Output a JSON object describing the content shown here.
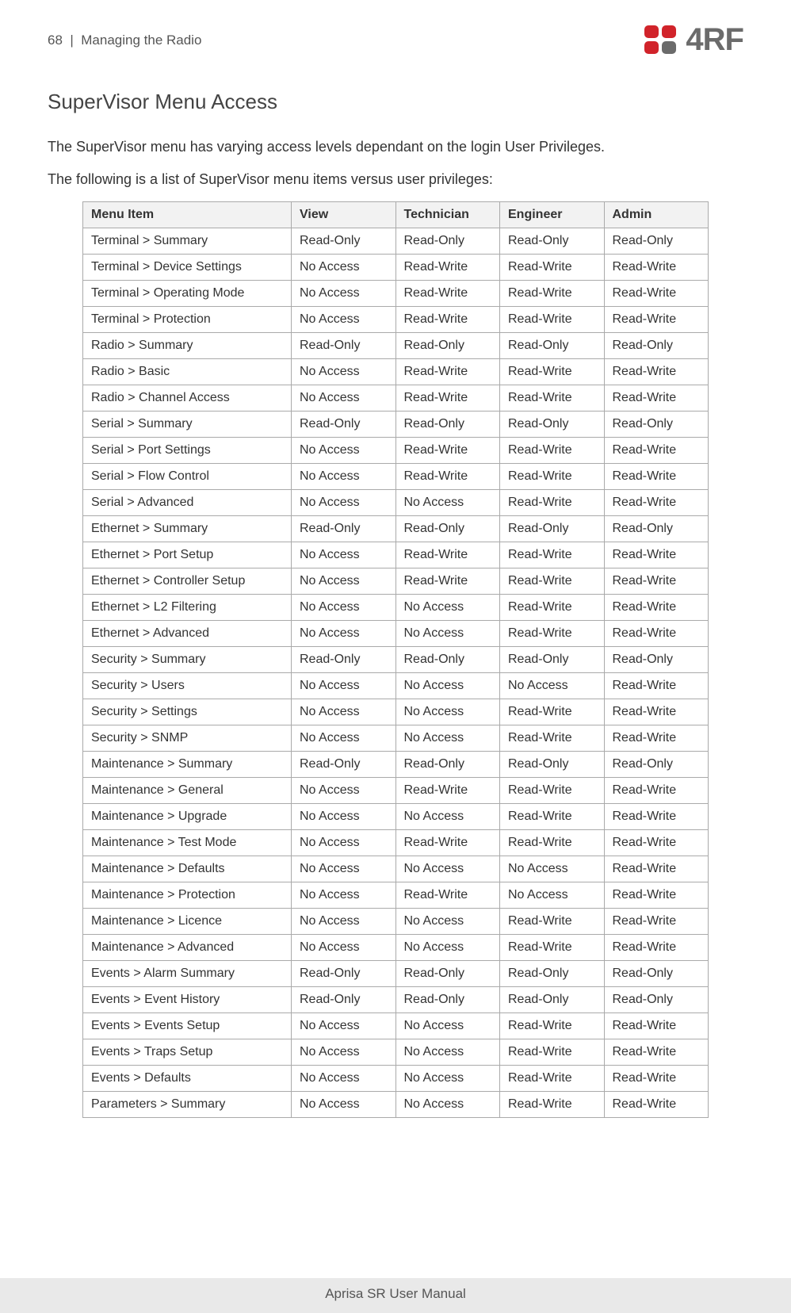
{
  "header": {
    "page_number": "68",
    "separator": "|",
    "chapter": "Managing the Radio",
    "logo_text": "4RF"
  },
  "section_title": "SuperVisor Menu Access",
  "paragraphs": [
    "The SuperVisor menu has varying access levels dependant on the login User Privileges.",
    "The following is a list of SuperVisor menu items versus user privileges:"
  ],
  "table": {
    "headers": [
      "Menu Item",
      "View",
      "Technician",
      "Engineer",
      "Admin"
    ],
    "rows": [
      [
        "Terminal > Summary",
        "Read-Only",
        "Read-Only",
        "Read-Only",
        "Read-Only"
      ],
      [
        "Terminal > Device Settings",
        "No Access",
        "Read-Write",
        "Read-Write",
        "Read-Write"
      ],
      [
        "Terminal > Operating Mode",
        "No Access",
        "Read-Write",
        "Read-Write",
        "Read-Write"
      ],
      [
        "Terminal > Protection",
        "No Access",
        "Read-Write",
        "Read-Write",
        "Read-Write"
      ],
      [
        "Radio > Summary",
        "Read-Only",
        "Read-Only",
        "Read-Only",
        "Read-Only"
      ],
      [
        "Radio > Basic",
        "No Access",
        "Read-Write",
        "Read-Write",
        "Read-Write"
      ],
      [
        "Radio > Channel Access",
        "No Access",
        "Read-Write",
        "Read-Write",
        "Read-Write"
      ],
      [
        "Serial > Summary",
        "Read-Only",
        "Read-Only",
        "Read-Only",
        "Read-Only"
      ],
      [
        "Serial > Port Settings",
        "No Access",
        "Read-Write",
        "Read-Write",
        "Read-Write"
      ],
      [
        "Serial > Flow Control",
        "No Access",
        "Read-Write",
        "Read-Write",
        "Read-Write"
      ],
      [
        "Serial > Advanced",
        "No Access",
        "No Access",
        "Read-Write",
        "Read-Write"
      ],
      [
        "Ethernet > Summary",
        "Read-Only",
        "Read-Only",
        "Read-Only",
        "Read-Only"
      ],
      [
        "Ethernet > Port Setup",
        "No Access",
        "Read-Write",
        "Read-Write",
        "Read-Write"
      ],
      [
        "Ethernet > Controller Setup",
        "No Access",
        "Read-Write",
        "Read-Write",
        "Read-Write"
      ],
      [
        "Ethernet > L2 Filtering",
        "No Access",
        "No Access",
        "Read-Write",
        "Read-Write"
      ],
      [
        "Ethernet > Advanced",
        "No Access",
        "No Access",
        "Read-Write",
        "Read-Write"
      ],
      [
        "Security > Summary",
        "Read-Only",
        "Read-Only",
        "Read-Only",
        "Read-Only"
      ],
      [
        "Security > Users",
        "No Access",
        "No Access",
        "No Access",
        "Read-Write"
      ],
      [
        "Security > Settings",
        "No Access",
        "No Access",
        "Read-Write",
        "Read-Write"
      ],
      [
        "Security > SNMP",
        "No Access",
        "No Access",
        "Read-Write",
        "Read-Write"
      ],
      [
        "Maintenance > Summary",
        "Read-Only",
        "Read-Only",
        "Read-Only",
        "Read-Only"
      ],
      [
        "Maintenance > General",
        "No Access",
        "Read-Write",
        "Read-Write",
        "Read-Write"
      ],
      [
        "Maintenance > Upgrade",
        "No Access",
        "No Access",
        "Read-Write",
        "Read-Write"
      ],
      [
        "Maintenance > Test Mode",
        "No Access",
        "Read-Write",
        "Read-Write",
        "Read-Write"
      ],
      [
        "Maintenance > Defaults",
        "No Access",
        "No Access",
        "No Access",
        "Read-Write"
      ],
      [
        "Maintenance > Protection",
        "No Access",
        "Read-Write",
        "No Access",
        "Read-Write"
      ],
      [
        "Maintenance > Licence",
        "No Access",
        "No Access",
        "Read-Write",
        "Read-Write"
      ],
      [
        "Maintenance > Advanced",
        "No Access",
        "No Access",
        "Read-Write",
        "Read-Write"
      ],
      [
        "Events > Alarm Summary",
        "Read-Only",
        "Read-Only",
        "Read-Only",
        "Read-Only"
      ],
      [
        "Events > Event History",
        "Read-Only",
        "Read-Only",
        "Read-Only",
        "Read-Only"
      ],
      [
        "Events > Events Setup",
        "No Access",
        "No Access",
        "Read-Write",
        "Read-Write"
      ],
      [
        "Events > Traps Setup",
        "No Access",
        "No Access",
        "Read-Write",
        "Read-Write"
      ],
      [
        "Events > Defaults",
        "No Access",
        "No Access",
        "Read-Write",
        "Read-Write"
      ],
      [
        "Parameters > Summary",
        "No Access",
        "No Access",
        "Read-Write",
        "Read-Write"
      ]
    ]
  },
  "footer": "Aprisa SR User Manual"
}
